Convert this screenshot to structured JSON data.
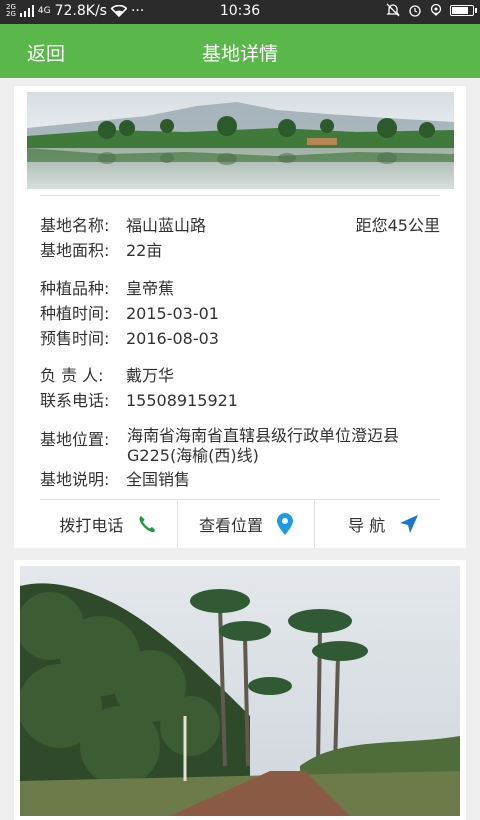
{
  "status_bar": {
    "network_top": "2G",
    "network_bottom": "2G",
    "net_type": "4G",
    "speed": "72.8K/s",
    "more": "···",
    "time": "10:36",
    "battery_level": 0.85
  },
  "header": {
    "back_label": "返回",
    "title": "基地详情"
  },
  "detail": {
    "name_label": "基地名称:",
    "name_value": "福山蓝山路",
    "distance": "距您45公里",
    "area_label": "基地面积:",
    "area_value": "22亩",
    "variety_label": "种植品种:",
    "variety_value": "皇帝蕉",
    "plant_time_label": "种植时间:",
    "plant_time_value": "2015-03-01",
    "presale_label": "预售时间:",
    "presale_value": "2016-08-03",
    "manager_label": "负 责 人:",
    "manager_value": "戴万华",
    "phone_label": "联系电话:",
    "phone_value": "15508915921",
    "location_label": "基地位置:",
    "location_value": "海南省海南省直辖县级行政单位澄迈县G225(海榆(西)线)",
    "note_label": "基地说明:",
    "note_value": "全国销售"
  },
  "actions": {
    "call_label": "拨打电话",
    "view_location_label": "查看位置",
    "navigate_label": "导 航"
  },
  "colors": {
    "header_green": "#5ab84b",
    "phone_icon_green": "#1a9a3c",
    "location_icon_blue": "#1e9be8",
    "nav_icon_blue": "#1976d2"
  }
}
